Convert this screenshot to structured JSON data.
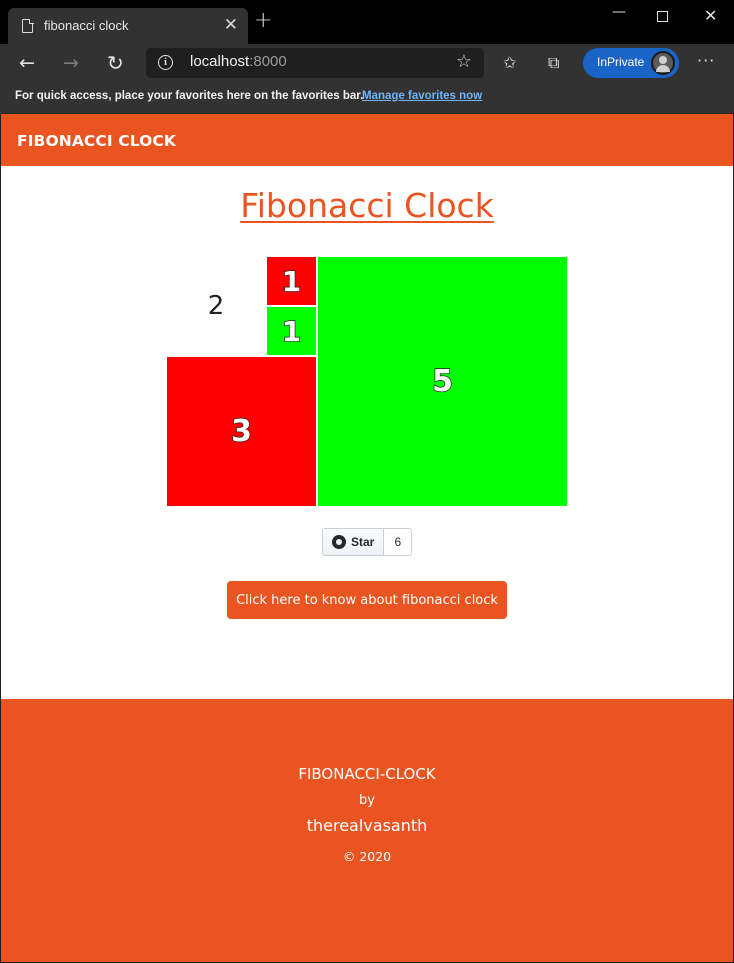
{
  "browser": {
    "tab_title": "fibonacci clock",
    "url_host": "localhost",
    "url_port": ":8000",
    "inprivate_label": "InPrivate",
    "favorites_message": "For quick access, place your favorites here on the favorites bar.",
    "favorites_link": "Manage favorites now"
  },
  "header": {
    "brand": "FIBONACCI CLOCK"
  },
  "main": {
    "title": "Fibonacci Clock",
    "squares": [
      {
        "label": "1",
        "color": "#ff0000"
      },
      {
        "label": "1",
        "color": "#00ff00"
      },
      {
        "label": "2",
        "color": "#ffffff"
      },
      {
        "label": "3",
        "color": "#ff0000"
      },
      {
        "label": "5",
        "color": "#00ff00"
      }
    ],
    "github": {
      "star_label": "Star",
      "star_count": "6"
    },
    "about_button": "Click here to know about fibonacci clock"
  },
  "footer": {
    "name": "FIBONACCI-CLOCK",
    "by": "by",
    "author": "therealvasanth",
    "copyright": "© 2020"
  },
  "colors": {
    "accent": "#e95420",
    "hour": "#ff0000",
    "minute": "#00ff00"
  }
}
